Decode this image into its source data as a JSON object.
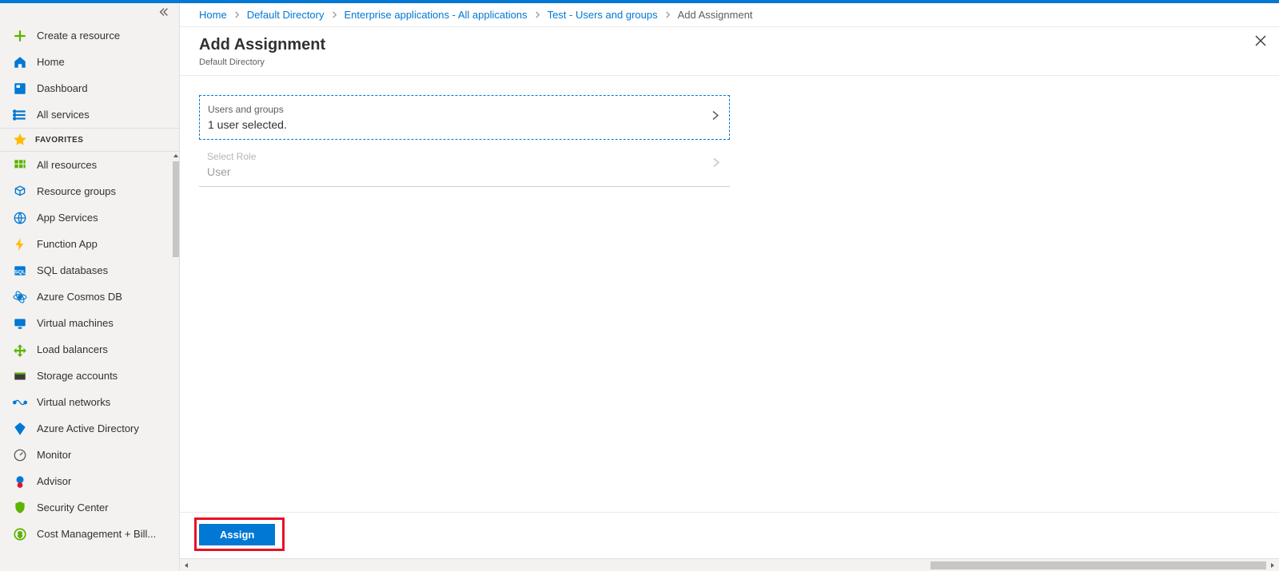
{
  "sidebar": {
    "create": "Create a resource",
    "home": "Home",
    "dashboard": "Dashboard",
    "all_services": "All services",
    "favorites_header": "FAVORITES",
    "items": [
      "All resources",
      "Resource groups",
      "App Services",
      "Function App",
      "SQL databases",
      "Azure Cosmos DB",
      "Virtual machines",
      "Load balancers",
      "Storage accounts",
      "Virtual networks",
      "Azure Active Directory",
      "Monitor",
      "Advisor",
      "Security Center",
      "Cost Management + Bill..."
    ]
  },
  "breadcrumb": {
    "home": "Home",
    "dir": "Default Directory",
    "ent": "Enterprise applications - All applications",
    "test": "Test - Users and groups",
    "current": "Add Assignment"
  },
  "blade": {
    "title": "Add Assignment",
    "subtitle": "Default Directory",
    "users_label": "Users and groups",
    "users_value": "1 user selected.",
    "role_label": "Select Role",
    "role_value": "User",
    "assign": "Assign"
  },
  "icon_colors": {
    "plus": "#5db300",
    "home": "#0078d4",
    "dashboard": "#0078d4",
    "list": "#0078d4",
    "star": "#ffb900",
    "grid": "#5db300",
    "cube": "#0078d4",
    "globe": "#0078d4",
    "bolt": "#ffb900",
    "sql": "#0078d4",
    "cosmos": "#0078d4",
    "vm": "#0078d4",
    "lb": "#5db300",
    "storage": "#3b3a39",
    "vnet": "#0078d4",
    "aad": "#0078d4",
    "monitor": "#605e5c",
    "advisor": "#e81123",
    "shield": "#5db300",
    "cost": "#5db300"
  }
}
